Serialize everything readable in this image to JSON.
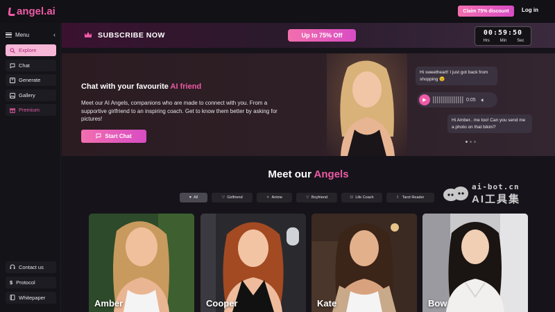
{
  "header": {
    "logo": "angel.ai",
    "claim_label": "Claim 75% discount",
    "login_label": "Log in"
  },
  "sidebar": {
    "menu_label": "Menu",
    "items": [
      {
        "label": "Explore",
        "icon": "search-icon"
      },
      {
        "label": "Chat",
        "icon": "chat-icon"
      },
      {
        "label": "Generate",
        "icon": "plus-square-icon"
      },
      {
        "label": "Gallery",
        "icon": "gallery-icon"
      },
      {
        "label": "Premium",
        "icon": "gift-icon"
      }
    ],
    "bottom_items": [
      {
        "label": "Contact us",
        "icon": "headset-icon"
      },
      {
        "label": "Protocol",
        "icon": "dollar-icon"
      },
      {
        "label": "Whitepaper",
        "icon": "book-icon"
      }
    ]
  },
  "subscribe": {
    "text": "SUBSCRIBE NOW",
    "button": "Up to 75% Off",
    "timer": {
      "digits": "00:59:50",
      "hrs": "Hrs",
      "min": "Min",
      "sec": "Sec"
    }
  },
  "hero": {
    "title_prefix": "Chat with your favourite ",
    "title_highlight": "AI friend",
    "description": "Meet our AI Angels, companions who are made to connect with you. From a supportive girlfriend to an inspiring coach. Get to know them better by asking for pictures!",
    "start_chat": "Start Chat",
    "bubble_1": "Hi sweetheart! I just got back from shopping 😉",
    "audio_time": "0:05",
    "bubble_2": "Hi Amber.. me too! Can you send me a photo on that bikini?"
  },
  "section": {
    "title_prefix": "Meet our ",
    "title_highlight": "Angels"
  },
  "filters": [
    {
      "label": "All",
      "icon": "heart-icon"
    },
    {
      "label": "Girlfriend",
      "icon": "heart-outline-icon"
    },
    {
      "label": "Anime",
      "icon": "sparkle-icon"
    },
    {
      "label": "Boyfriend",
      "icon": "heart-outline-icon"
    },
    {
      "label": "Life Coach",
      "icon": "people-icon"
    },
    {
      "label": "Tarot Reader",
      "icon": "moon-icon"
    }
  ],
  "cards": [
    {
      "name": "Amber"
    },
    {
      "name": "Cooper"
    },
    {
      "name": "Kate"
    },
    {
      "name": "Bow"
    }
  ],
  "watermark": {
    "url": "ai-bot.cn",
    "cn": "AI工具集"
  },
  "colors": {
    "accent": "#ee5aa6",
    "background": "#16141a"
  }
}
